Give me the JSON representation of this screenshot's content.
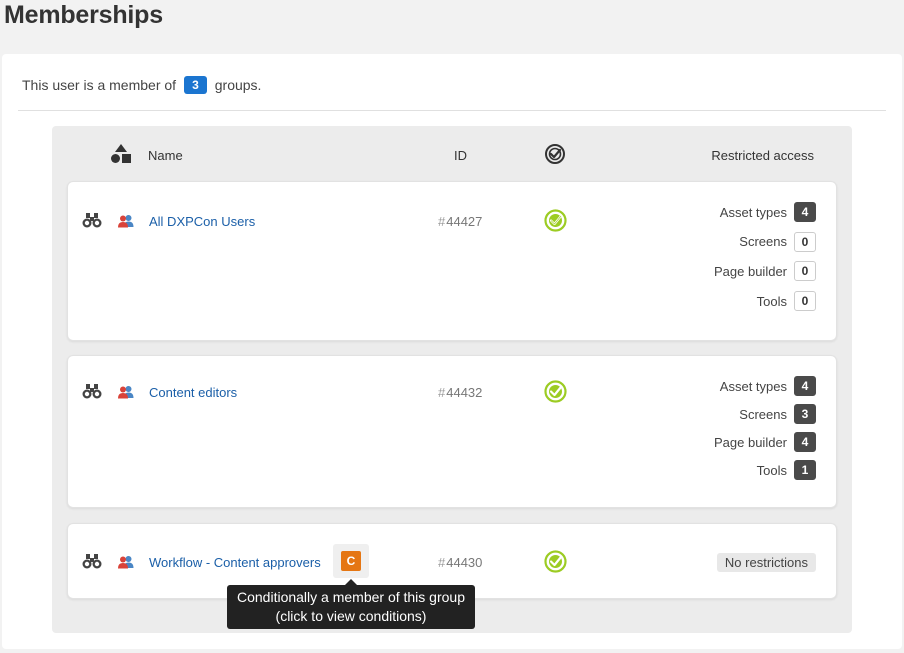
{
  "page": {
    "title": "Memberships"
  },
  "summary": {
    "prefix": "This user is a member of",
    "count": "3",
    "suffix": "groups."
  },
  "table": {
    "headers": {
      "name": "Name",
      "id": "ID",
      "restricted": "Restricted access"
    }
  },
  "groups": [
    {
      "name": "All DXPCon Users",
      "id_hash": "#",
      "id": "44427",
      "restrictions": [
        {
          "label": "Asset types",
          "count": "4"
        },
        {
          "label": "Screens",
          "count": "0"
        },
        {
          "label": "Page builder",
          "count": "0"
        },
        {
          "label": "Tools",
          "count": "0"
        }
      ]
    },
    {
      "name": "Content editors",
      "id_hash": "#",
      "id": "44432",
      "restrictions": [
        {
          "label": "Asset types",
          "count": "4"
        },
        {
          "label": "Screens",
          "count": "3"
        },
        {
          "label": "Page builder",
          "count": "4"
        },
        {
          "label": "Tools",
          "count": "1"
        }
      ]
    },
    {
      "name": "Workflow - Content approvers",
      "id_hash": "#",
      "id": "44430",
      "conditional_badge": "C",
      "no_restrictions": "No restrictions"
    }
  ],
  "tooltip": {
    "line1": "Conditionally a member of this group",
    "line2": "(click to view conditions)"
  },
  "icons": {
    "view": "binoculars-icon",
    "group": "users-icon",
    "active": "check-circle-icon",
    "type": "shapes-icon"
  },
  "colors": {
    "accent": "#1b75d0",
    "link": "#1b5fa8",
    "active": "#9ccc23",
    "conditional": "#e57613"
  }
}
